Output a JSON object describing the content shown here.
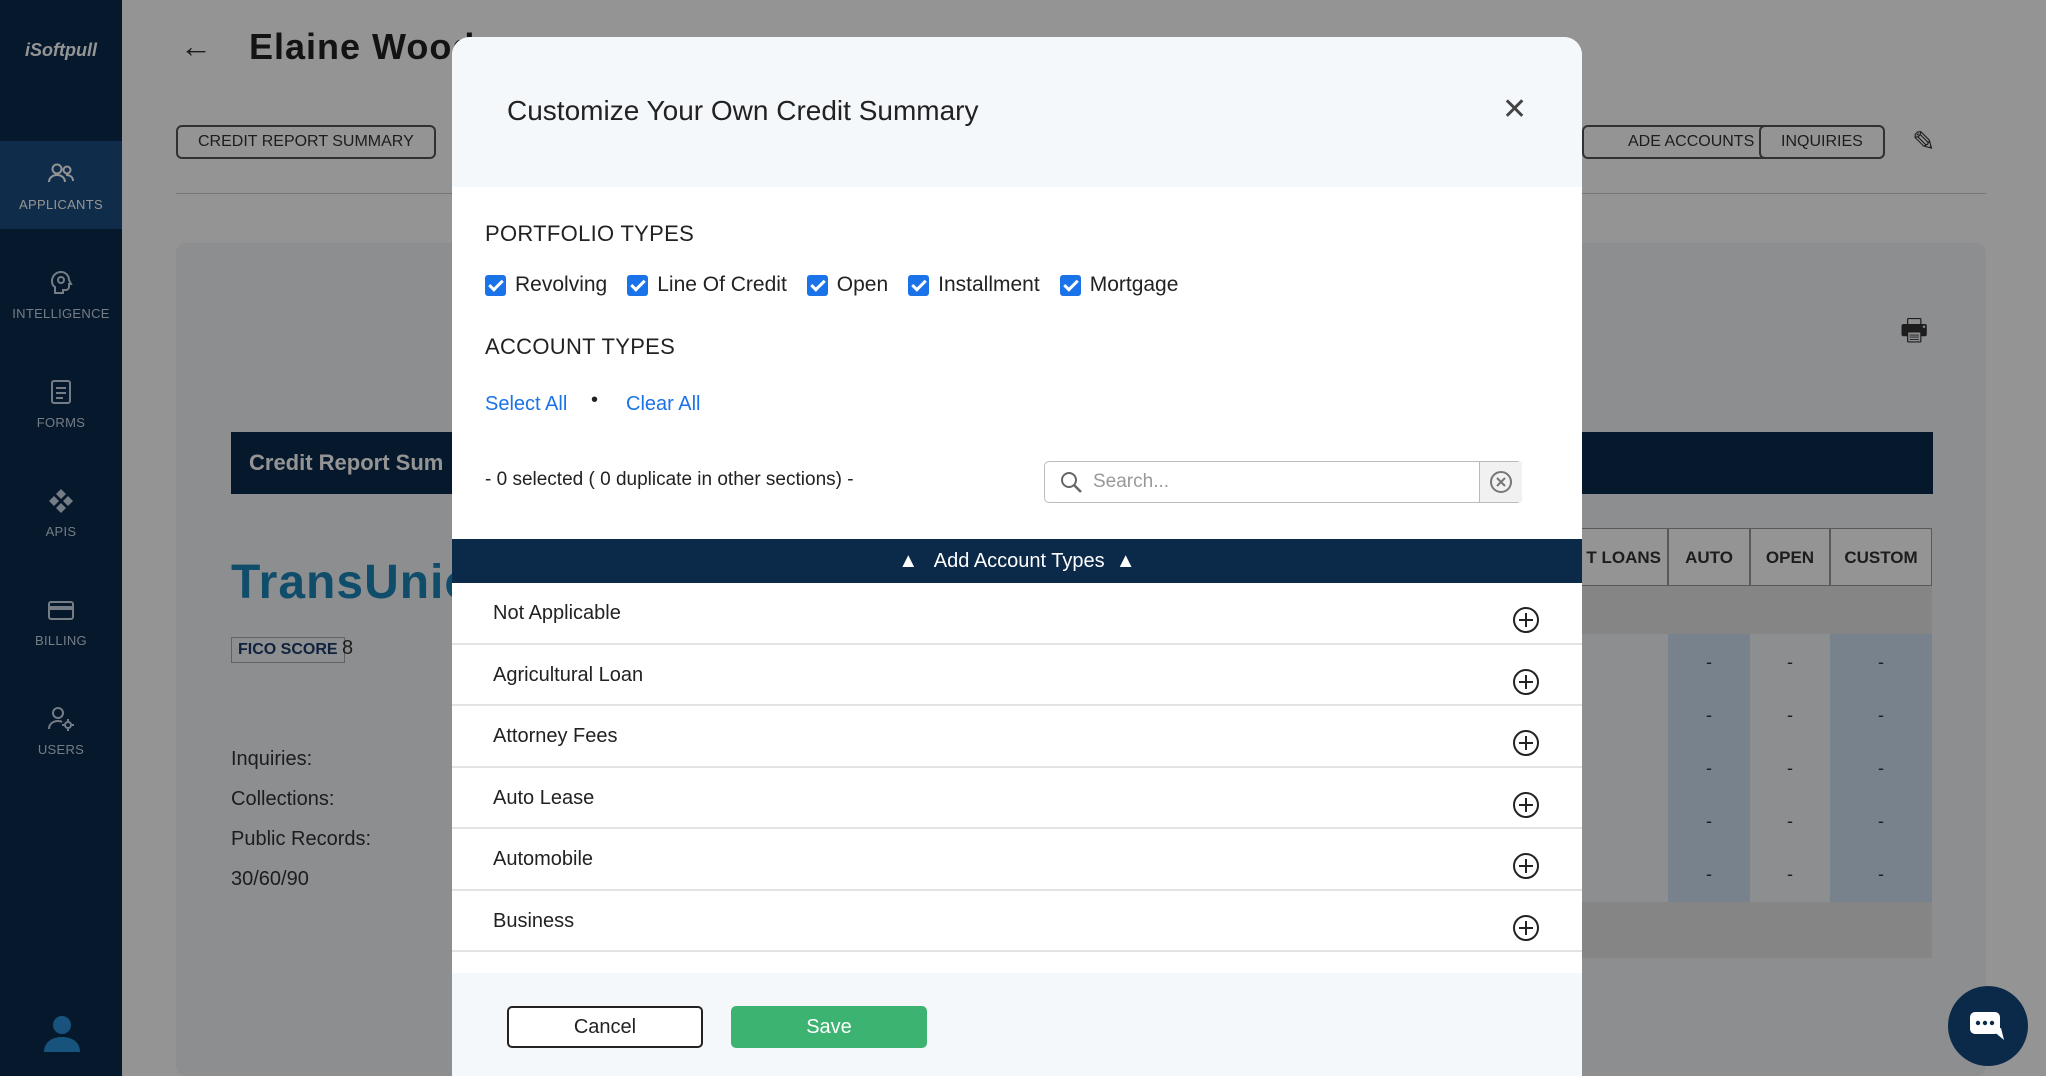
{
  "sidebar": {
    "logo": "iSoftpull",
    "items": [
      {
        "label": "APPLICANTS",
        "icon": "users-icon",
        "active": true
      },
      {
        "label": "INTELLIGENCE",
        "icon": "brain-icon"
      },
      {
        "label": "FORMS",
        "icon": "document-icon"
      },
      {
        "label": "APIS",
        "icon": "api-icon"
      },
      {
        "label": "BILLING",
        "icon": "credit-card-icon"
      },
      {
        "label": "USERS",
        "icon": "user-settings-icon"
      }
    ]
  },
  "background": {
    "applicant_name": "Elaine Wood",
    "tabs": [
      "CREDIT REPORT SUMMARY",
      "ADE ACCOUNTS",
      "INQUIRIES"
    ],
    "summary_title": "Credit Report Sum",
    "bureau": "TransUnio",
    "fico_label": "FICO SCORE",
    "fico_value": "8",
    "stats": [
      "Inquiries:",
      "Collections:",
      "Public Records:",
      "30/60/90"
    ],
    "table_headers": [
      "T LOANS",
      "AUTO",
      "OPEN",
      "CUSTOM"
    ],
    "cell_value": "-"
  },
  "modal": {
    "title": "Customize Your Own Credit Summary",
    "portfolio_label": "PORTFOLIO TYPES",
    "portfolio_types": [
      "Revolving",
      "Line Of Credit",
      "Open",
      "Installment",
      "Mortgage"
    ],
    "account_label": "ACCOUNT TYPES",
    "select_all": "Select All",
    "separator": "•",
    "clear_all": "Clear All",
    "selected_info": "- 0 selected ( 0 duplicate in other sections) -",
    "search_placeholder": "Search...",
    "accordion_label": "Add Account Types",
    "account_types": [
      "Not Applicable",
      "Agricultural Loan",
      "Attorney Fees",
      "Auto Lease",
      "Automobile",
      "Business"
    ],
    "cancel_label": "Cancel",
    "save_label": "Save"
  },
  "colors": {
    "sidebar_bg": "#0b2a4a",
    "accent_blue": "#1a73e8",
    "save_green": "#3cb371"
  }
}
